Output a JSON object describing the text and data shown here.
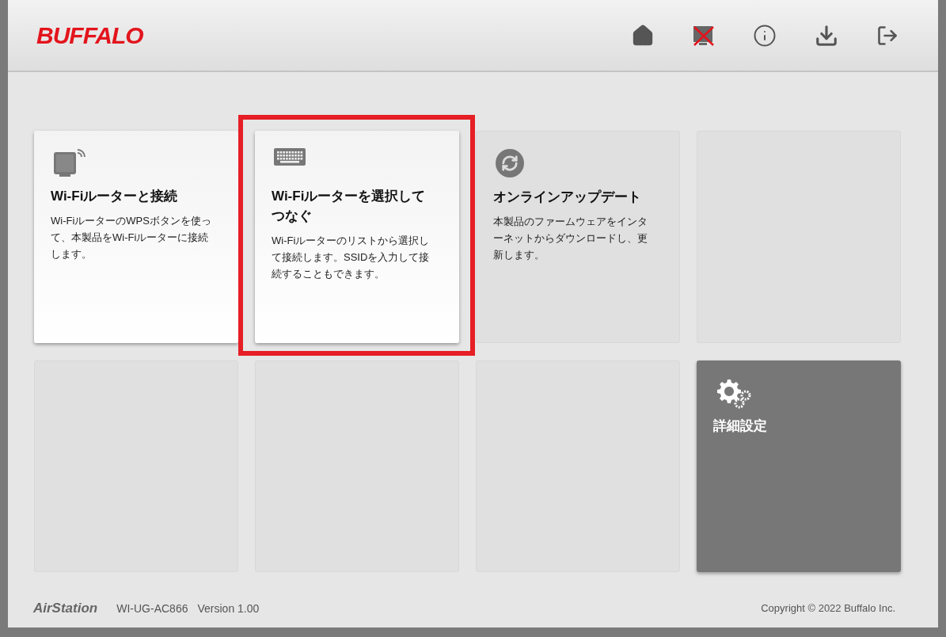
{
  "header": {
    "logo": "BUFFALO"
  },
  "tiles": [
    {
      "kind": "wps",
      "title": "Wi-Fiルーターと接続",
      "description": "Wi-FiルーターのWPSボタンを使って、本製品をWi-Fiルーターに接続します。",
      "disabled": false,
      "highlighted": false
    },
    {
      "kind": "keyboard",
      "title": "Wi-Fiルーターを選択してつなぐ",
      "description": "Wi-Fiルーターのリストから選択して接続します。SSIDを入力して接続することもできます。",
      "disabled": false,
      "highlighted": true
    },
    {
      "kind": "update",
      "title": "オンラインアップデート",
      "description": "本製品のファームウェアをインターネットからダウンロードし、更新します。",
      "disabled": true,
      "highlighted": false
    },
    {
      "kind": "blank"
    },
    {
      "kind": "blank"
    },
    {
      "kind": "blank"
    },
    {
      "kind": "blank"
    },
    {
      "kind": "settings",
      "title": "詳細設定",
      "disabled": false,
      "highlighted": false
    }
  ],
  "footer": {
    "brand": "AirStation",
    "model": "WI-UG-AC866",
    "version": "Version 1.00",
    "copyright": "Copyright © 2022 Buffalo Inc."
  }
}
